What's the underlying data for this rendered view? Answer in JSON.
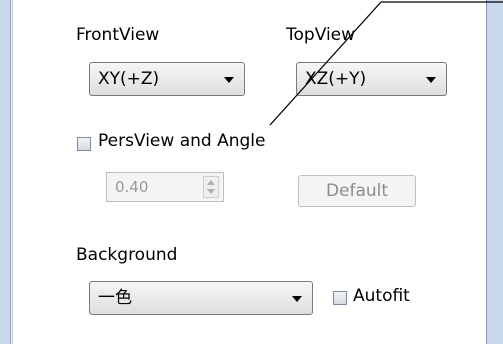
{
  "view": {
    "front_label": "FrontView",
    "top_label": "TopView",
    "front_value": "XY(+Z)",
    "top_value": "XZ(+Y)"
  },
  "perspective": {
    "label": "PersView and Angle",
    "checked": false,
    "angle_value": "0.40",
    "default_label": "Default"
  },
  "background": {
    "label": "Background",
    "value": "一色",
    "autofit_label": "Autofit",
    "autofit_checked": false
  },
  "colors": {
    "panel_border": "#c9d7ea",
    "disabled_text": "#8c8c8c",
    "annotation_line": "#000000"
  },
  "icons": [
    "chevron-down-icon",
    "spin-up-icon",
    "spin-down-icon",
    "checkbox-icon"
  ]
}
